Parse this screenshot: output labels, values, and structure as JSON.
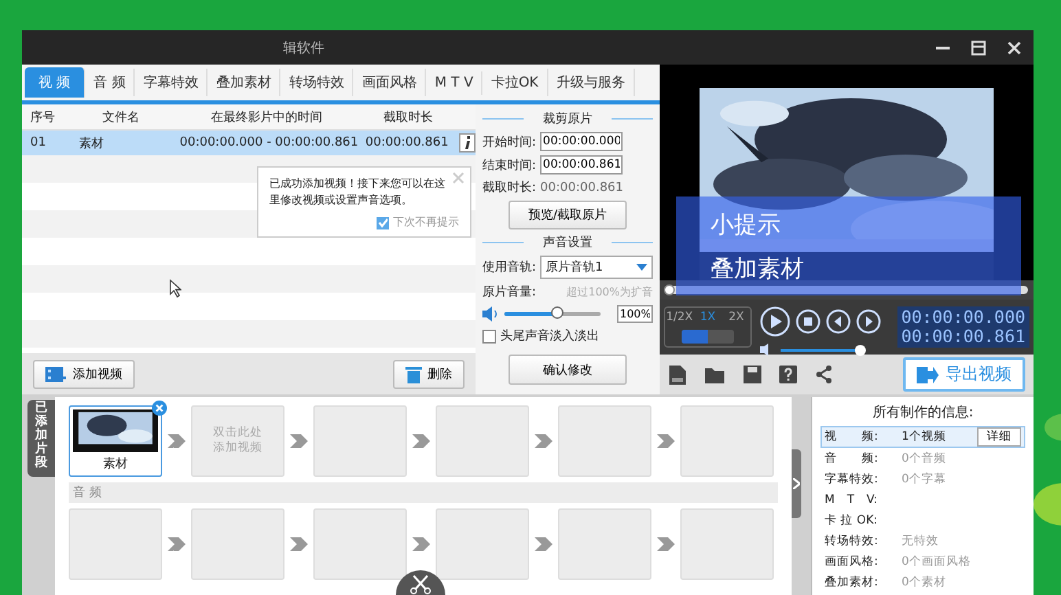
{
  "window": {
    "title": "辑软件"
  },
  "tabs": [
    {
      "label": "视 频",
      "selected": true
    },
    {
      "label": "音 频",
      "selected": false
    },
    {
      "label": "字幕特效",
      "selected": false
    },
    {
      "label": "叠加素材",
      "selected": false
    },
    {
      "label": "转场特效",
      "selected": false
    },
    {
      "label": "画面风格",
      "selected": false
    },
    {
      "label": "M T V",
      "selected": false
    },
    {
      "label": "卡拉OK",
      "selected": false
    },
    {
      "label": "升级与服务",
      "selected": false
    }
  ],
  "table": {
    "columns": [
      "序号",
      "文件名",
      "在最终影片中的时间",
      "截取时长"
    ],
    "rows": [
      {
        "cells": [
          "01",
          "素材",
          "00:00:00.000 - 00:00:00.861",
          "00:00:00.861"
        ],
        "selected": true
      }
    ]
  },
  "popup": {
    "message": "已成功添加视频！接下来您可以在这里修改视频或设置声音选项。",
    "checkbox": {
      "label": "下次不再提示",
      "checked": true
    }
  },
  "list_buttons": [
    "添加视频",
    "删除"
  ],
  "trim": {
    "title": "裁剪原片",
    "fields": [
      {
        "label": "开始时间:",
        "value": "00:00:00.000"
      },
      {
        "label": "结束时间:",
        "value": "00:00:00.861"
      }
    ],
    "duration_label": "截取时长:",
    "duration": "00:00:00.861",
    "button": "预览/截取原片"
  },
  "sound": {
    "title": "声音设置",
    "track_label": "使用音轨:",
    "track": "原片音轨1",
    "volume_label": "原片音量:",
    "volume_hint": "超过100%为扩音",
    "volume": {
      "level": 0.55
    },
    "volume_value": "100%",
    "fade": {
      "label": "头尾声音淡入淡出",
      "checked": false
    },
    "confirm": "确认修改"
  },
  "overlay": {
    "lines": [
      "小提示",
      "叠加素材"
    ]
  },
  "player": {
    "speeds": [
      {
        "label": "1/2X",
        "selected": false
      },
      {
        "label": "1X",
        "selected": true
      },
      {
        "label": "2X",
        "selected": false
      }
    ],
    "progress": {
      "level": 0
    },
    "speed_slider": {
      "level": 0.5
    },
    "volume": {
      "level": 1
    },
    "time_current": "00:00:00.000",
    "time_total": "00:00:00.861"
  },
  "export_button": "导出视频",
  "timeline": {
    "tab": "已添加片段",
    "clips": [
      {
        "kind": "clip",
        "label": "素材"
      },
      {
        "kind": "add",
        "label": "双击此处添加视频"
      },
      {
        "kind": "empty"
      },
      {
        "kind": "empty"
      },
      {
        "kind": "empty"
      },
      {
        "kind": "empty"
      }
    ],
    "audio_label": "音 频"
  },
  "info": {
    "title": "所有制作的信息:",
    "rows": [
      {
        "label": "视　　频:",
        "value": "1个视频",
        "selected": true,
        "button": "详细"
      },
      {
        "label": "音　　频:",
        "value": "0个音频",
        "selected": false
      },
      {
        "label": "字幕特效:",
        "value": "0个字幕",
        "selected": false
      },
      {
        "label": "M　T　V:",
        "selected": false
      },
      {
        "label": "卡 拉 OK:",
        "selected": false
      },
      {
        "label": "转场特效:",
        "value": "无特效",
        "selected": false
      },
      {
        "label": "画面风格:",
        "value": "0个画面风格",
        "selected": false
      },
      {
        "label": "叠加素材:",
        "value": "0个素材",
        "selected": false
      }
    ]
  }
}
